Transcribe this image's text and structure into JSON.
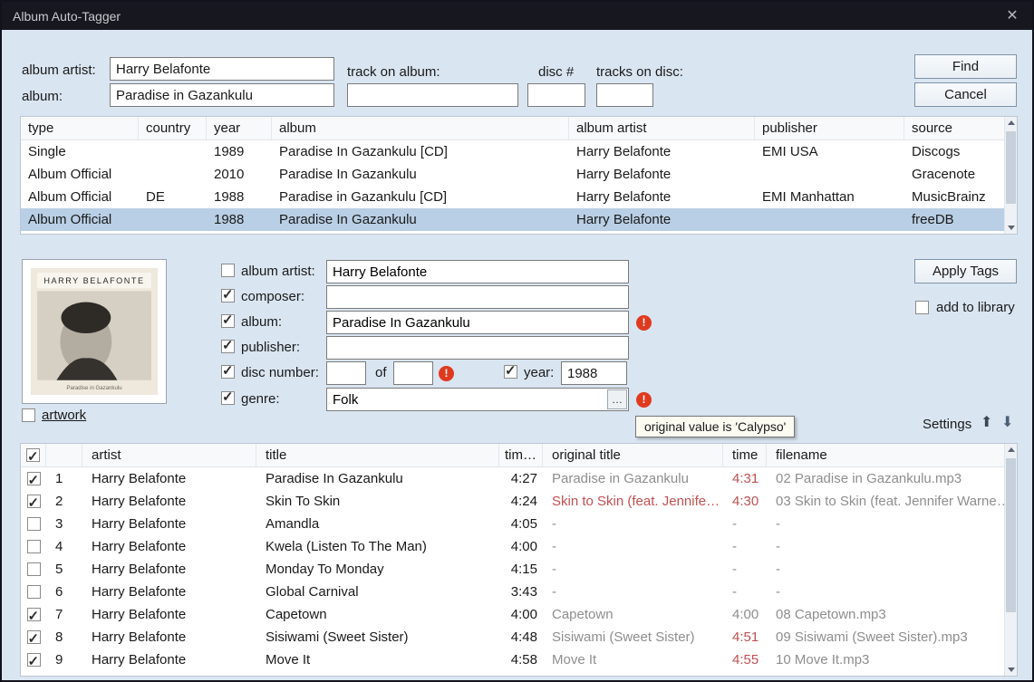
{
  "window": {
    "title": "Album Auto-Tagger",
    "close_glyph": "✕"
  },
  "search": {
    "album_artist_label": "album artist:",
    "album_artist_value": "Harry Belafonte",
    "album_label": "album:",
    "album_value": "Paradise in Gazankulu",
    "track_on_album_label": "track on album:",
    "track_on_album_value": "",
    "disc_label": "disc #",
    "disc_value": "",
    "tracks_on_disc_label": "tracks on disc:",
    "tracks_on_disc_value": "",
    "find_label": "Find",
    "cancel_label": "Cancel"
  },
  "results": {
    "columns": [
      "type",
      "country",
      "year",
      "album",
      "album artist",
      "publisher",
      "source"
    ],
    "selected_index": 3,
    "rows": [
      [
        "Single",
        "",
        "1989",
        "Paradise In Gazankulu  [CD]",
        "Harry Belafonte",
        "EMI USA",
        "Discogs"
      ],
      [
        "Album Official",
        "",
        "2010",
        "Paradise In Gazankulu",
        "Harry Belafonte",
        "",
        "Gracenote"
      ],
      [
        "Album Official",
        "DE",
        "1988",
        "Paradise in Gazankulu  [CD]",
        "Harry Belafonte",
        "EMI Manhattan",
        "MusicBrainz"
      ],
      [
        "Album Official",
        "",
        "1988",
        "Paradise In Gazankulu",
        "Harry Belafonte",
        "",
        "freeDB"
      ]
    ]
  },
  "artwork": {
    "cover_title": "HARRY BELAFONTE",
    "cover_caption": "Paradise in Gazankulu",
    "label": "artwork",
    "checked": false
  },
  "tags": {
    "fields": [
      {
        "label": "album artist:",
        "checked": false,
        "value": "Harry Belafonte",
        "warning": false
      },
      {
        "label": "composer:",
        "checked": true,
        "value": "",
        "warning": false
      },
      {
        "label": "album:",
        "checked": true,
        "value": "Paradise In Gazankulu",
        "warning": true
      },
      {
        "label": "publisher:",
        "checked": true,
        "value": "",
        "warning": false
      }
    ],
    "disc_number_label": "disc number:",
    "disc_number_checked": true,
    "disc_number_value": "",
    "of_label": "of",
    "disc_count_value": "",
    "disc_count_warning": true,
    "year_label": "year:",
    "year_checked": true,
    "year_value": "1988",
    "genre_label": "genre:",
    "genre_checked": true,
    "genre_value": "Folk",
    "genre_browse_label": "…",
    "genre_warning": true,
    "tooltip_text": "original value is 'Calypso'",
    "apply_button_label": "Apply Tags",
    "add_to_library_label": "add to library",
    "add_to_library_checked": false,
    "settings_label": "Settings",
    "up_arrow_glyph": "⬆",
    "down_arrow_glyph": "⬇"
  },
  "tracks": {
    "select_all_checked": true,
    "columns": {
      "artist": "artist",
      "title": "title",
      "time_new": "tim…",
      "original_title": "original title",
      "time": "time",
      "filename": "filename"
    },
    "rows": [
      {
        "checked": true,
        "num": "1",
        "artist": "Harry Belafonte",
        "title": "Paradise In Gazankulu",
        "time_new": "4:27",
        "original_title": "Paradise in Gazankulu",
        "orig_red": false,
        "time": "4:31",
        "time_red": true,
        "filename": "02 Paradise in Gazankulu.mp3"
      },
      {
        "checked": true,
        "num": "2",
        "artist": "Harry Belafonte",
        "title": "Skin To Skin",
        "time_new": "4:24",
        "original_title": "Skin to Skin (feat. Jennife…",
        "orig_red": true,
        "time": "4:30",
        "time_red": true,
        "filename": "03 Skin to Skin (feat. Jennifer Warne…"
      },
      {
        "checked": false,
        "num": "3",
        "artist": "Harry Belafonte",
        "title": "Amandla",
        "time_new": "4:05",
        "original_title": "-",
        "orig_red": false,
        "time": "-",
        "time_red": false,
        "filename": "-"
      },
      {
        "checked": false,
        "num": "4",
        "artist": "Harry Belafonte",
        "title": "Kwela (Listen To The Man)",
        "time_new": "4:00",
        "original_title": "-",
        "orig_red": false,
        "time": "-",
        "time_red": false,
        "filename": "-"
      },
      {
        "checked": false,
        "num": "5",
        "artist": "Harry Belafonte",
        "title": "Monday To Monday",
        "time_new": "4:15",
        "original_title": "-",
        "orig_red": false,
        "time": "-",
        "time_red": false,
        "filename": "-"
      },
      {
        "checked": false,
        "num": "6",
        "artist": "Harry Belafonte",
        "title": "Global Carnival",
        "time_new": "3:43",
        "original_title": "-",
        "orig_red": false,
        "time": "-",
        "time_red": false,
        "filename": "-"
      },
      {
        "checked": true,
        "num": "7",
        "artist": "Harry Belafonte",
        "title": "Capetown",
        "time_new": "4:00",
        "original_title": "Capetown",
        "orig_red": false,
        "time": "4:00",
        "time_red": false,
        "filename": "08 Capetown.mp3"
      },
      {
        "checked": true,
        "num": "8",
        "artist": "Harry Belafonte",
        "title": "Sisiwami (Sweet Sister)",
        "time_new": "4:48",
        "original_title": "Sisiwami (Sweet Sister)",
        "orig_red": false,
        "time": "4:51",
        "time_red": true,
        "filename": "09 Sisiwami (Sweet Sister).mp3"
      },
      {
        "checked": true,
        "num": "9",
        "artist": "Harry Belafonte",
        "title": "Move It",
        "time_new": "4:58",
        "original_title": "Move It",
        "orig_red": false,
        "time": "4:55",
        "time_red": true,
        "filename": "10 Move It.mp3"
      }
    ]
  },
  "colors": {
    "titlebar_bg": "#17171f",
    "body_bg": "#d9e5f1",
    "selected_row_bg": "#b9cfe5",
    "warning_red": "#e03a1e",
    "changed_red": "#c25050",
    "muted_gray": "#8e8e8e"
  }
}
